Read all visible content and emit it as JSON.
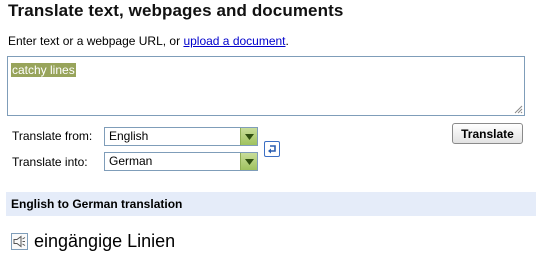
{
  "header": {
    "title": "Translate text, webpages and documents"
  },
  "instructions": {
    "text": "Enter text or a webpage URL, or ",
    "link": "upload a document",
    "suffix": "."
  },
  "input": {
    "value": "catchy lines"
  },
  "controls": {
    "from_label": "Translate from:",
    "from_value": "English",
    "into_label": "Translate into:",
    "into_value": "German",
    "translate_label": "Translate",
    "swap_icon": "swap-languages-icon"
  },
  "result": {
    "header": "English to German translation",
    "text": "eingängige Linien",
    "speaker_icon": "speaker-icon"
  },
  "colors": {
    "selection": "#98a45b",
    "dropdown_arrow": "#9fc25e",
    "result_bar": "#e5ecf9",
    "link": "#0000cc"
  }
}
